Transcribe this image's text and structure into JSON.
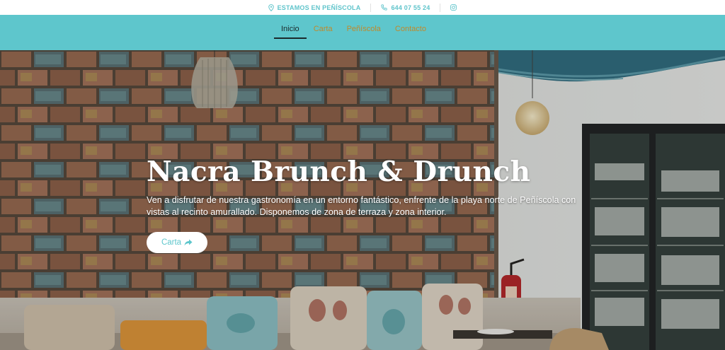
{
  "topbar": {
    "location_label": "ESTAMOS EN PEÑÍSCOLA",
    "phone": "644 07 55 24",
    "location_icon": "map-pin-icon",
    "phone_icon": "phone-icon",
    "social_icon": "instagram-icon"
  },
  "nav": {
    "items": [
      {
        "label": "Inicio",
        "active": true
      },
      {
        "label": "Carta"
      },
      {
        "label": "Peñíscola"
      },
      {
        "label": "Contacto"
      }
    ]
  },
  "hero": {
    "title": "Nacra Brunch & Drunch",
    "description": "Ven a disfrutar de nuestra gastronomía en un entorno fantástico, enfrente de la playa norte de Peñíscola con vistas al recinto amurallado. Disponemos de zona de terraza y zona interior.",
    "button_label": "Carta",
    "button_icon": "share-arrow-icon"
  },
  "colors": {
    "accent": "#5ec6cc",
    "nav_link": "#c0892a",
    "nav_active": "#1b2a2c"
  }
}
